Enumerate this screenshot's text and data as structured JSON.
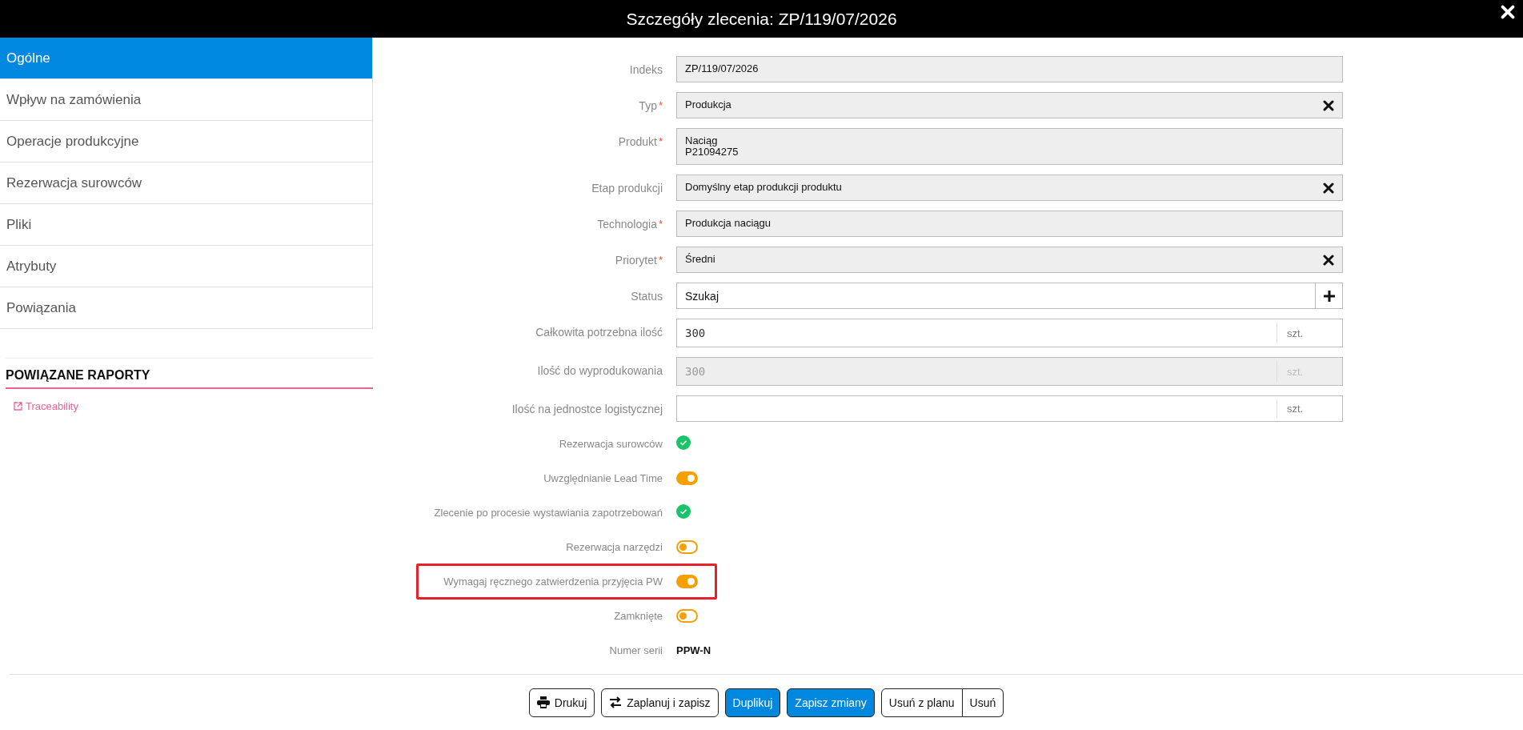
{
  "window": {
    "title": "Szczegóły zlecenia: ZP/119/07/2026"
  },
  "sidebar": {
    "items": [
      {
        "label": "Ogólne",
        "selected": true
      },
      {
        "label": "Wpływ na zamówienia",
        "selected": false
      },
      {
        "label": "Operacje produkcyjne",
        "selected": false
      },
      {
        "label": "Rezerwacja surowców",
        "selected": false
      },
      {
        "label": "Pliki",
        "selected": false
      },
      {
        "label": "Atrybuty",
        "selected": false
      },
      {
        "label": "Powiązania",
        "selected": false
      }
    ],
    "reports": {
      "title": "POWIĄZANE RAPORTY",
      "links": [
        "Traceability"
      ]
    }
  },
  "form": {
    "fields": [
      {
        "label": "Indeks",
        "kind": "readonly",
        "lines": [
          "ZP/119/07/2026"
        ]
      },
      {
        "label": "Typ",
        "marker": "*",
        "kind": "select",
        "lines": [
          "Produkcja"
        ]
      },
      {
        "label": "Produkt",
        "marker": "*",
        "kind": "readonly",
        "lines": [
          "Naciąg",
          "P21094275"
        ]
      },
      {
        "label": "Etap produkcji",
        "kind": "select",
        "lines": [
          "Domyślny etap produkcji produktu"
        ]
      },
      {
        "label": "Technologia",
        "marker": "*",
        "kind": "readonly",
        "lines": [
          "Produkcja naciągu"
        ]
      },
      {
        "label": "Priorytet",
        "marker": "*",
        "kind": "select",
        "lines": [
          "Średni"
        ]
      },
      {
        "label": "Status",
        "kind": "search",
        "placeholder": "Szukaj"
      },
      {
        "label": "Całkowita potrzebna ilość",
        "kind": "quantity",
        "disabled": false,
        "value": "300",
        "unit": "szt."
      },
      {
        "label": "Ilość do wyprodukowania",
        "kind": "quantity",
        "disabled": true,
        "value": "300",
        "unit": "szt."
      },
      {
        "label": "Ilość na jednostce logistycznej",
        "kind": "quantity",
        "disabled": false,
        "unit": "szt."
      }
    ],
    "flags": [
      {
        "label": "Rezerwacja surowców",
        "kind": "check",
        "highlighted": false
      },
      {
        "label": "Uwzględnianie Lead Time",
        "kind": "toggle",
        "on": true,
        "highlighted": false
      },
      {
        "label": "Zlecenie po procesie wystawiania zapotrzebowań",
        "kind": "check",
        "highlighted": false
      },
      {
        "label": "Rezerwacja narzędzi",
        "kind": "toggle",
        "on": false,
        "highlighted": false
      },
      {
        "label": "Wymagaj ręcznego zatwierdzenia przyjęcia PW",
        "kind": "toggle",
        "on": true,
        "highlighted": true
      },
      {
        "label": "Zamknięte",
        "kind": "toggle",
        "on": false,
        "highlighted": false
      },
      {
        "label": "Numer serii",
        "kind": "text",
        "value": "PPW-N",
        "highlighted": false
      }
    ]
  },
  "buttons": [
    {
      "label": "Drukuj",
      "kind": "print",
      "primary": false
    },
    {
      "label": "Zaplanuj i zapisz",
      "kind": "swap",
      "primary": false
    },
    {
      "label": "Duplikuj",
      "kind": "plain",
      "primary": true
    },
    {
      "label": "Zapisz zmiany",
      "kind": "plain",
      "primary": true
    },
    {
      "label": "Usuń z planu",
      "kind": "group-start",
      "primary": false
    },
    {
      "label": "Usuń",
      "kind": "group-end",
      "primary": false
    }
  ]
}
